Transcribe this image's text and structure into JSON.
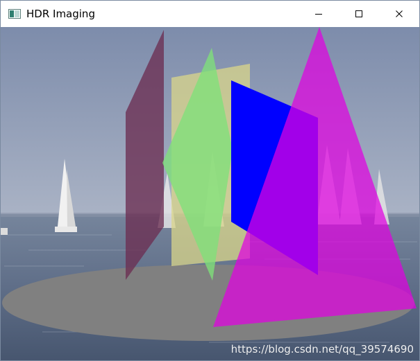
{
  "window": {
    "title": "HDR Imaging",
    "icon": "app-window-icon"
  },
  "controls": {
    "minimize_icon": "minimize-icon",
    "maximize_icon": "maximize-icon",
    "close_icon": "close-icon"
  },
  "scene": {
    "background": "sailboats-on-water-photo",
    "colors": {
      "sky_top": "#8391b0",
      "sky_bottom": "#a9b3c6",
      "water_top": "#6f7f98",
      "water_bottom": "#4e5d78",
      "ellipse": "#808080",
      "maroon_panel": "#6b2e52",
      "yellow_panel": "#d9d58a",
      "green_diamond": "#7fe07a",
      "blue_panel": "#0000ff",
      "magenta_triangle": "#e000e0"
    }
  },
  "watermark": {
    "text": "https://blog.csdn.net/qq_39574690"
  }
}
